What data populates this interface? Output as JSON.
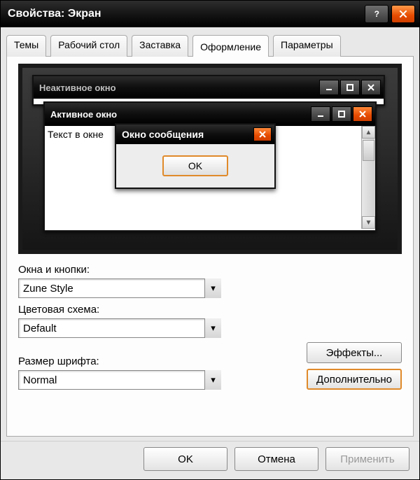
{
  "titlebar": {
    "title": "Свойства: Экран"
  },
  "tabs": [
    "Темы",
    "Рабочий стол",
    "Заставка",
    "Оформление",
    "Параметры"
  ],
  "active_tab_index": 3,
  "preview": {
    "inactive_window_title": "Неактивное окно",
    "active_window_title": "Активное окно",
    "body_text": "Текст в окне",
    "msgbox_title": "Окно сообщения",
    "msgbox_ok": "OK"
  },
  "labels": {
    "windows_buttons": "Окна и кнопки:",
    "color_scheme": "Цветовая схема:",
    "font_size": "Размер шрифта:"
  },
  "selects": {
    "windows_buttons": "Zune Style",
    "color_scheme": "Default",
    "font_size": "Normal"
  },
  "buttons": {
    "effects": "Эффекты...",
    "advanced": "Дополнительно",
    "ok": "OK",
    "cancel": "Отмена",
    "apply": "Применить"
  }
}
